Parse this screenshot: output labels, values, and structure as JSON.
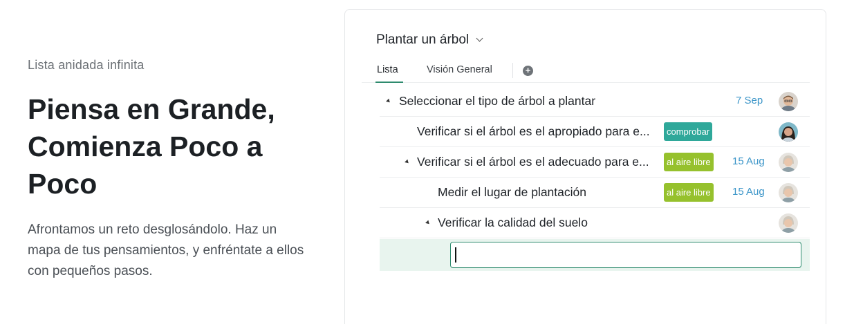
{
  "intro": {
    "eyebrow": "Lista anidada infinita",
    "headline": "Piensa en Grande, Comienza Poco a Poco",
    "description": "Afrontamos un reto desglosándolo. Haz un mapa de tus pensamientos, y enfréntate a ellos con pequeños pasos."
  },
  "project": {
    "title": "Plantar un árbol",
    "title_icon": "chevron-down-icon"
  },
  "tabs": [
    {
      "label": "Lista",
      "active": true
    },
    {
      "label": "Visión General",
      "active": false
    }
  ],
  "add_tab_icon": "plus-circle-icon",
  "rows": [
    {
      "text": "Seleccionar el tipo de árbol a plantar",
      "expanded": true,
      "tag": null,
      "date": "7 Sep",
      "avatar": "man-glasses"
    },
    {
      "text": "Verificar si el árbol es el apropiado para e...",
      "expanded": false,
      "tag": "comprobar",
      "date": "",
      "avatar": "woman-dark-hair"
    },
    {
      "text": "Verificar si el árbol es el adecuado para e...",
      "expanded": true,
      "tag": "al aire libre",
      "date": "15 Aug",
      "avatar": "older-person"
    },
    {
      "text": "Medir el lugar de plantación",
      "expanded": false,
      "tag": "al aire libre",
      "date": "15 Aug",
      "avatar": "older-person"
    },
    {
      "text": "Verificar la calidad del suelo",
      "expanded": true,
      "tag": null,
      "date": "",
      "avatar": "older-person"
    }
  ],
  "new_item_input": {
    "value": "",
    "placeholder": ""
  },
  "colors": {
    "accent_green": "#2e8b6e",
    "tag_teal": "#2fa89a",
    "tag_lime": "#96c12d",
    "date_blue": "#3b95c8",
    "input_row_bg": "#e8f4ee"
  }
}
